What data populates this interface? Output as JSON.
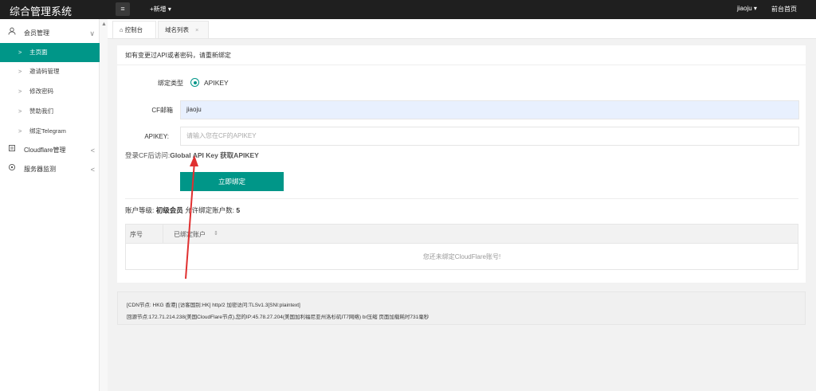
{
  "app": {
    "title": "综合管理系统",
    "menu_toggle": "≡",
    "add_new": "+新增 ▾"
  },
  "topnav": {
    "user": "jiaoju ▾",
    "home": "前台首页"
  },
  "sidebar": {
    "groups": [
      {
        "icon": "user-icon",
        "label": "会员管理",
        "arrow": "∨"
      },
      {
        "icon": "cloud-icon",
        "label": "Cloudflare管理",
        "arrow": "<"
      },
      {
        "icon": "server-icon",
        "label": "服务器监测",
        "arrow": "<"
      }
    ],
    "items": [
      {
        "label": "主页面",
        "active": true
      },
      {
        "label": "邀请码管理"
      },
      {
        "label": "修改密码"
      },
      {
        "label": "赞助我们"
      },
      {
        "label": "绑定Telegram"
      }
    ],
    "chevron": ">"
  },
  "tabs": [
    {
      "label": "控制台"
    },
    {
      "label": "域名列表",
      "close": "×"
    }
  ],
  "card": {
    "header": "如有变更过API或者密码，请重新绑定",
    "bind_type_label": "绑定类型",
    "bind_type_value": "APIKEY",
    "cf_email_label": "CF邮箱",
    "cf_email_value": "jiaoju",
    "apikey_label": "APIKEY:",
    "apikey_placeholder": "请输入您在CF的APIKEY",
    "hint_prefix": "登录CF后访问:",
    "hint_bold": "Global API Key 获取APIKEY",
    "bind_button": "立即绑定",
    "level_prefix": "账户等级: ",
    "level_value": "初级会员",
    "level_mid": " 允许绑定账户数: ",
    "level_count": "5",
    "table": {
      "col1": "序号",
      "col2": "已绑定账户",
      "sort": "⇕",
      "empty": "您还未绑定CloudFlare账号!"
    }
  },
  "footer": {
    "line1": "[CDN节点: HKG 香港] [访客国别:HK] http/2 加密访问:TLSv1.3[SNI:plaintext]",
    "line2": "回源节点:172.71.214.238(美国CloudFlare节点),您的IP:45.78.27.204(美国加利福尼亚州洛杉矶IT7网络) br压缩 页面加载耗时731毫秒"
  },
  "colors": {
    "accent": "#009688",
    "topbar": "#1f1f1f",
    "arrow": "#e03030"
  }
}
